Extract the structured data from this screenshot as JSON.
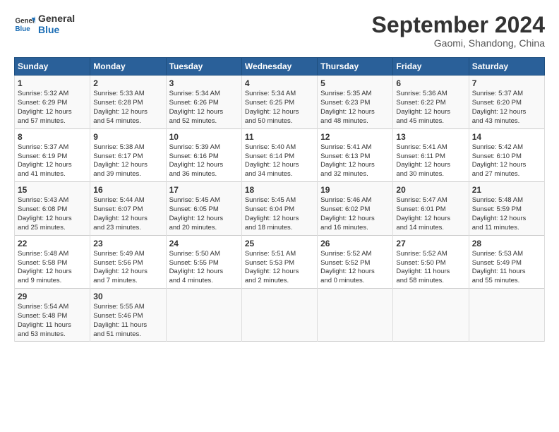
{
  "logo": {
    "line1": "General",
    "line2": "Blue"
  },
  "title": "September 2024",
  "subtitle": "Gaomi, Shandong, China",
  "headers": [
    "Sunday",
    "Monday",
    "Tuesday",
    "Wednesday",
    "Thursday",
    "Friday",
    "Saturday"
  ],
  "weeks": [
    [
      {
        "day": "1",
        "lines": [
          "Sunrise: 5:32 AM",
          "Sunset: 6:29 PM",
          "Daylight: 12 hours",
          "and 57 minutes."
        ]
      },
      {
        "day": "2",
        "lines": [
          "Sunrise: 5:33 AM",
          "Sunset: 6:28 PM",
          "Daylight: 12 hours",
          "and 54 minutes."
        ]
      },
      {
        "day": "3",
        "lines": [
          "Sunrise: 5:34 AM",
          "Sunset: 6:26 PM",
          "Daylight: 12 hours",
          "and 52 minutes."
        ]
      },
      {
        "day": "4",
        "lines": [
          "Sunrise: 5:34 AM",
          "Sunset: 6:25 PM",
          "Daylight: 12 hours",
          "and 50 minutes."
        ]
      },
      {
        "day": "5",
        "lines": [
          "Sunrise: 5:35 AM",
          "Sunset: 6:23 PM",
          "Daylight: 12 hours",
          "and 48 minutes."
        ]
      },
      {
        "day": "6",
        "lines": [
          "Sunrise: 5:36 AM",
          "Sunset: 6:22 PM",
          "Daylight: 12 hours",
          "and 45 minutes."
        ]
      },
      {
        "day": "7",
        "lines": [
          "Sunrise: 5:37 AM",
          "Sunset: 6:20 PM",
          "Daylight: 12 hours",
          "and 43 minutes."
        ]
      }
    ],
    [
      {
        "day": "8",
        "lines": [
          "Sunrise: 5:37 AM",
          "Sunset: 6:19 PM",
          "Daylight: 12 hours",
          "and 41 minutes."
        ]
      },
      {
        "day": "9",
        "lines": [
          "Sunrise: 5:38 AM",
          "Sunset: 6:17 PM",
          "Daylight: 12 hours",
          "and 39 minutes."
        ]
      },
      {
        "day": "10",
        "lines": [
          "Sunrise: 5:39 AM",
          "Sunset: 6:16 PM",
          "Daylight: 12 hours",
          "and 36 minutes."
        ]
      },
      {
        "day": "11",
        "lines": [
          "Sunrise: 5:40 AM",
          "Sunset: 6:14 PM",
          "Daylight: 12 hours",
          "and 34 minutes."
        ]
      },
      {
        "day": "12",
        "lines": [
          "Sunrise: 5:41 AM",
          "Sunset: 6:13 PM",
          "Daylight: 12 hours",
          "and 32 minutes."
        ]
      },
      {
        "day": "13",
        "lines": [
          "Sunrise: 5:41 AM",
          "Sunset: 6:11 PM",
          "Daylight: 12 hours",
          "and 30 minutes."
        ]
      },
      {
        "day": "14",
        "lines": [
          "Sunrise: 5:42 AM",
          "Sunset: 6:10 PM",
          "Daylight: 12 hours",
          "and 27 minutes."
        ]
      }
    ],
    [
      {
        "day": "15",
        "lines": [
          "Sunrise: 5:43 AM",
          "Sunset: 6:08 PM",
          "Daylight: 12 hours",
          "and 25 minutes."
        ]
      },
      {
        "day": "16",
        "lines": [
          "Sunrise: 5:44 AM",
          "Sunset: 6:07 PM",
          "Daylight: 12 hours",
          "and 23 minutes."
        ]
      },
      {
        "day": "17",
        "lines": [
          "Sunrise: 5:45 AM",
          "Sunset: 6:05 PM",
          "Daylight: 12 hours",
          "and 20 minutes."
        ]
      },
      {
        "day": "18",
        "lines": [
          "Sunrise: 5:45 AM",
          "Sunset: 6:04 PM",
          "Daylight: 12 hours",
          "and 18 minutes."
        ]
      },
      {
        "day": "19",
        "lines": [
          "Sunrise: 5:46 AM",
          "Sunset: 6:02 PM",
          "Daylight: 12 hours",
          "and 16 minutes."
        ]
      },
      {
        "day": "20",
        "lines": [
          "Sunrise: 5:47 AM",
          "Sunset: 6:01 PM",
          "Daylight: 12 hours",
          "and 14 minutes."
        ]
      },
      {
        "day": "21",
        "lines": [
          "Sunrise: 5:48 AM",
          "Sunset: 5:59 PM",
          "Daylight: 12 hours",
          "and 11 minutes."
        ]
      }
    ],
    [
      {
        "day": "22",
        "lines": [
          "Sunrise: 5:48 AM",
          "Sunset: 5:58 PM",
          "Daylight: 12 hours",
          "and 9 minutes."
        ]
      },
      {
        "day": "23",
        "lines": [
          "Sunrise: 5:49 AM",
          "Sunset: 5:56 PM",
          "Daylight: 12 hours",
          "and 7 minutes."
        ]
      },
      {
        "day": "24",
        "lines": [
          "Sunrise: 5:50 AM",
          "Sunset: 5:55 PM",
          "Daylight: 12 hours",
          "and 4 minutes."
        ]
      },
      {
        "day": "25",
        "lines": [
          "Sunrise: 5:51 AM",
          "Sunset: 5:53 PM",
          "Daylight: 12 hours",
          "and 2 minutes."
        ]
      },
      {
        "day": "26",
        "lines": [
          "Sunrise: 5:52 AM",
          "Sunset: 5:52 PM",
          "Daylight: 12 hours",
          "and 0 minutes."
        ]
      },
      {
        "day": "27",
        "lines": [
          "Sunrise: 5:52 AM",
          "Sunset: 5:50 PM",
          "Daylight: 11 hours",
          "and 58 minutes."
        ]
      },
      {
        "day": "28",
        "lines": [
          "Sunrise: 5:53 AM",
          "Sunset: 5:49 PM",
          "Daylight: 11 hours",
          "and 55 minutes."
        ]
      }
    ],
    [
      {
        "day": "29",
        "lines": [
          "Sunrise: 5:54 AM",
          "Sunset: 5:48 PM",
          "Daylight: 11 hours",
          "and 53 minutes."
        ]
      },
      {
        "day": "30",
        "lines": [
          "Sunrise: 5:55 AM",
          "Sunset: 5:46 PM",
          "Daylight: 11 hours",
          "and 51 minutes."
        ]
      },
      {
        "day": "",
        "lines": []
      },
      {
        "day": "",
        "lines": []
      },
      {
        "day": "",
        "lines": []
      },
      {
        "day": "",
        "lines": []
      },
      {
        "day": "",
        "lines": []
      }
    ]
  ]
}
